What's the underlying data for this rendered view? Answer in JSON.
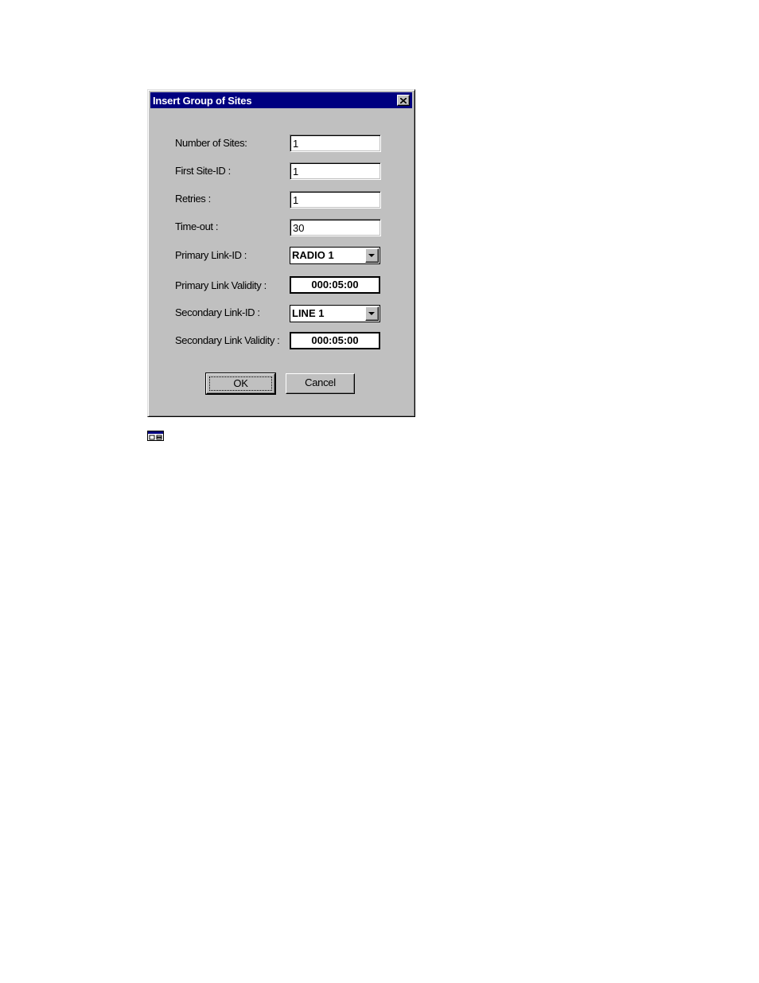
{
  "dialog": {
    "title": "Insert Group of Sites",
    "fields": {
      "number_of_sites": {
        "label": "Number of Sites:",
        "value": "1"
      },
      "first_site_id": {
        "label": "First Site-ID :",
        "value": "1"
      },
      "retries": {
        "label": "Retries :",
        "value": "1"
      },
      "timeout": {
        "label": "Time-out :",
        "value": "30"
      },
      "primary_link_id": {
        "label": "Primary Link-ID :",
        "value": "RADIO 1"
      },
      "primary_link_validity": {
        "label": "Primary Link Validity :",
        "value": "000:05:00"
      },
      "secondary_link_id": {
        "label": "Secondary Link-ID :",
        "value": "LINE 1"
      },
      "secondary_link_validity": {
        "label": "Secondary Link Validity :",
        "value": "000:05:00"
      }
    },
    "buttons": {
      "ok": "OK",
      "cancel": "Cancel"
    }
  },
  "icons": {
    "close": "close-icon",
    "dropdown": "chevron-down-icon",
    "dialog_caption": "dialog-window-icon"
  },
  "colors": {
    "titlebar": "#000080",
    "dialog_face": "#c0c0c0",
    "field_background": "#ffffff"
  }
}
